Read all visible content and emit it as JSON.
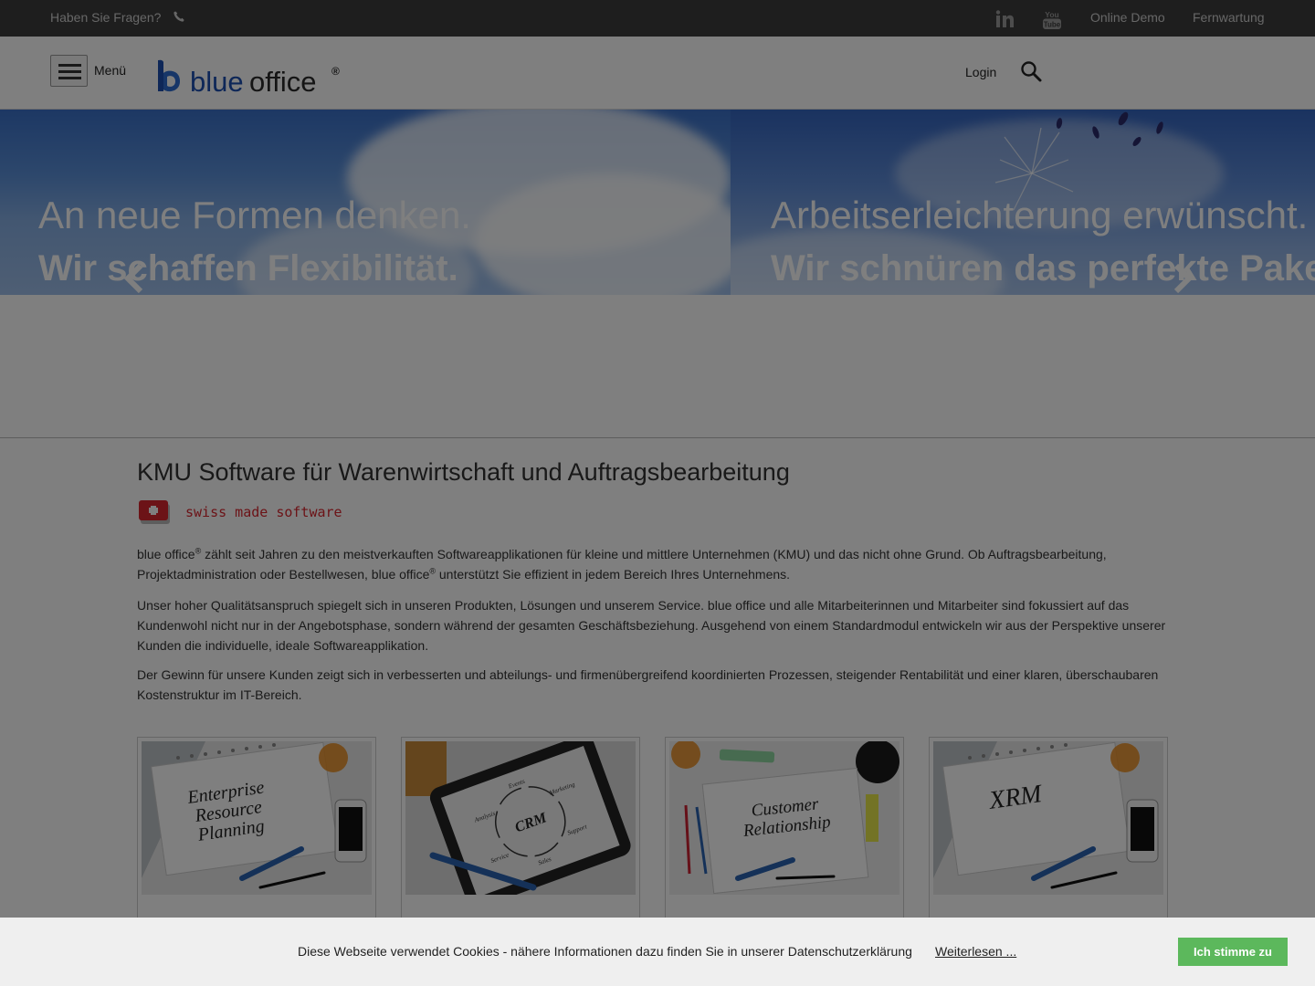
{
  "topbar": {
    "question": "Haben Sie Fragen?",
    "phone_icon": "phone-icon",
    "social_icons": [
      "linkedin-icon",
      "youtube-icon"
    ],
    "youtube_text": "You Tube",
    "links": [
      "Online Demo",
      "Fernwartung"
    ]
  },
  "header": {
    "menu_label": "Menü",
    "logo_text_blue": "blue",
    "logo_text_office": "office",
    "logo_reg": "®",
    "login": "Login",
    "search_icon": "search-icon"
  },
  "hero": {
    "slides": [
      {
        "line1": "An neue Formen denken.",
        "line2": "Wir schaffen Flexibilität."
      },
      {
        "line1": "Arbeitserleichterung erwünscht.",
        "line2": "Wir schnüren das perfekte Paket."
      }
    ],
    "prev_icon": "chevron-left-icon",
    "next_icon": "chevron-right-icon"
  },
  "main": {
    "title": "KMU Software für Warenwirtschaft und Auftragsbearbeitung",
    "badge": "swiss made software",
    "p1": {
      "a": "blue office",
      "reg": "®",
      "b": " zählt seit Jahren zu den meistverkauften Softwareapplikationen für kleine und mittlere Unternehmen (KMU) und das nicht ohne Grund. Ob Auftragsbearbeitung, Projektadministration oder Bestellwesen, blue office",
      "c": " unterstützt Sie effizient in jedem Bereich Ihres Unternehmens."
    },
    "p2": "Unser hoher Qualitätsanspruch spiegelt sich in unseren Produkten, Lösungen und unserem Service. blue office und alle Mitarbeiterinnen und Mitarbeiter sind fokussiert auf das Kundenwohl nicht nur in der Angebotsphase, sondern während der gesamten Geschäftsbeziehung. Ausgehend von einem Standardmodul entwickeln wir aus der Perspektive unserer Kunden die individuelle, ideale Softwareapplikation.",
    "p3": "Der Gewinn für unsere Kunden zeigt sich in verbesserten und abteilungs- und firmenübergreifend koordinierten Prozessen, steigender Rentabilität und einer klaren, überschaubaren Kostenstruktur im IT-Bereich."
  },
  "cards": [
    {
      "lines": [
        "Enterprise",
        "Resource",
        "Planning"
      ]
    },
    {
      "center": "CRM",
      "ring": [
        "Marketing",
        "Support",
        "Sales",
        "Service",
        "Analysis",
        "Events"
      ]
    },
    {
      "lines": [
        "Customer",
        "Relationship"
      ]
    },
    {
      "lines": [
        "XRM"
      ]
    }
  ],
  "cookie": {
    "text": "Diese Webseite verwendet Cookies - nähere Informationen dazu finden Sie in unserer Datenschutzerklärung",
    "more": "Weiterlesen ...",
    "accept": "Ich stimme zu"
  }
}
